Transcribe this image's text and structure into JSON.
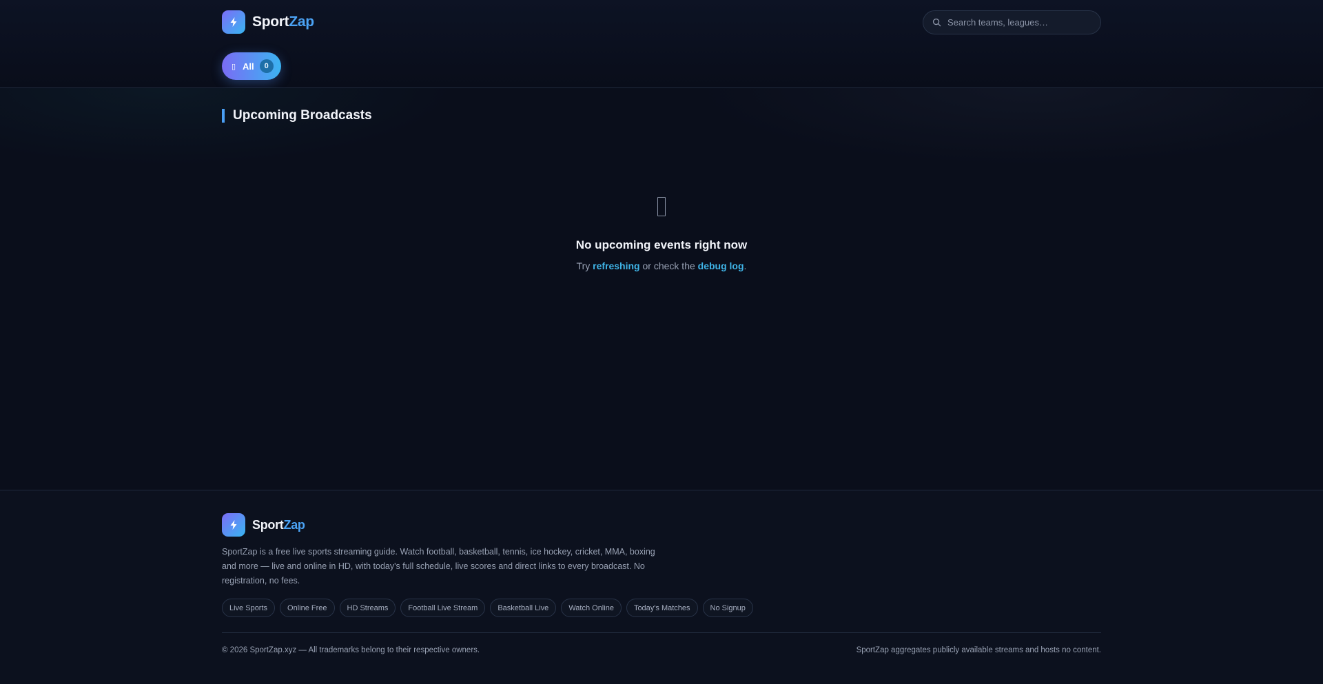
{
  "brand": {
    "sport": "Sport",
    "zap": "Zap"
  },
  "search": {
    "placeholder": "Search teams, leagues…"
  },
  "filter": {
    "icon": "grid-icon",
    "label": "All",
    "count": "0"
  },
  "main": {
    "title": "Upcoming Broadcasts",
    "empty": {
      "icon": "tv-icon",
      "title": "No upcoming events right now",
      "try": "Try",
      "refresh_link": "refreshing",
      "middle": "or check the",
      "debug_link": "debug log",
      "end": "."
    }
  },
  "footer": {
    "brand": {
      "sport": "Sport",
      "zap": "Zap"
    },
    "description": "SportZap is a free live sports streaming guide. Watch football, basketball, tennis, ice hockey, cricket, MMA, boxing and more — live and online in HD, with today's full schedule, live scores and direct links to every broadcast. No registration, no fees.",
    "tags": [
      "Live Sports",
      "Online Free",
      "HD Streams",
      "Football Live Stream",
      "Basketball Live",
      "Watch Online",
      "Today's Matches",
      "No Signup"
    ],
    "copyright": "© 2026 SportZap.xyz — All trademarks belong to their respective owners.",
    "note": "SportZap aggregates publicly available streams and hosts no content."
  },
  "colors": {
    "accent": "#4ba3f5",
    "link": "#3fb3e6",
    "background": "#0a0e1b"
  }
}
